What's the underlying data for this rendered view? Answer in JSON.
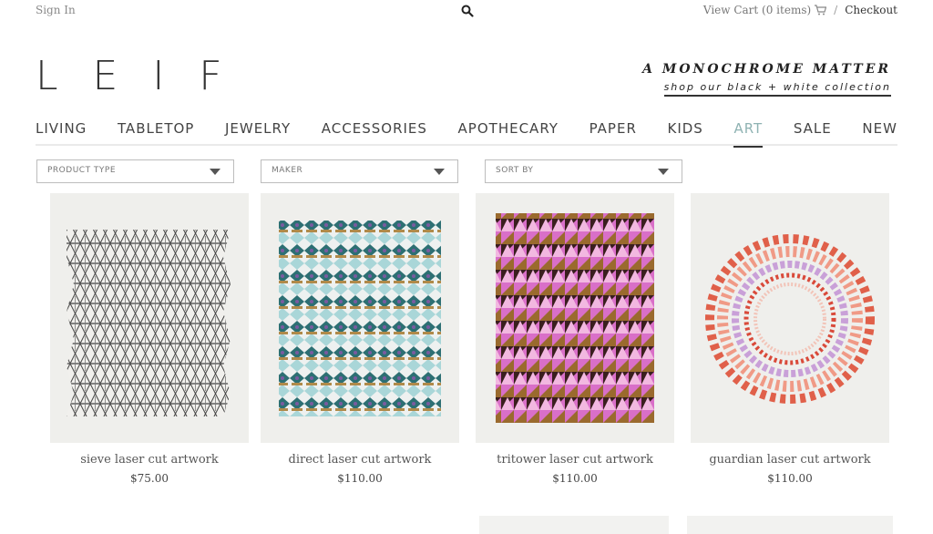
{
  "header": {
    "sign_in": "Sign In",
    "view_cart": "View Cart (0 items)",
    "separator": "/",
    "checkout": "Checkout"
  },
  "logo": "LEIF",
  "promo": {
    "title": "A MONOCHROME MATTER",
    "subtitle": "shop our black + white collection"
  },
  "nav": {
    "items": [
      "LIVING",
      "TABLETOP",
      "JEWELRY",
      "ACCESSORIES",
      "APOTHECARY",
      "PAPER",
      "KIDS",
      "ART",
      "SALE",
      "NEW"
    ],
    "active": "ART",
    "active_color": "#8fb3b3"
  },
  "filters": [
    {
      "label": "PRODUCT TYPE"
    },
    {
      "label": "MAKER"
    },
    {
      "label": "SORT BY"
    }
  ],
  "products": [
    {
      "name": "sieve laser cut artwork",
      "price": "$75.00"
    },
    {
      "name": "direct laser cut artwork",
      "price": "$110.00"
    },
    {
      "name": "tritower laser cut artwork",
      "price": "$110.00"
    },
    {
      "name": "guardian laser cut artwork",
      "price": "$110.00"
    }
  ],
  "icons": {
    "search": "search-icon",
    "cart": "cart-icon",
    "dropdown": "chevron-down-icon"
  }
}
